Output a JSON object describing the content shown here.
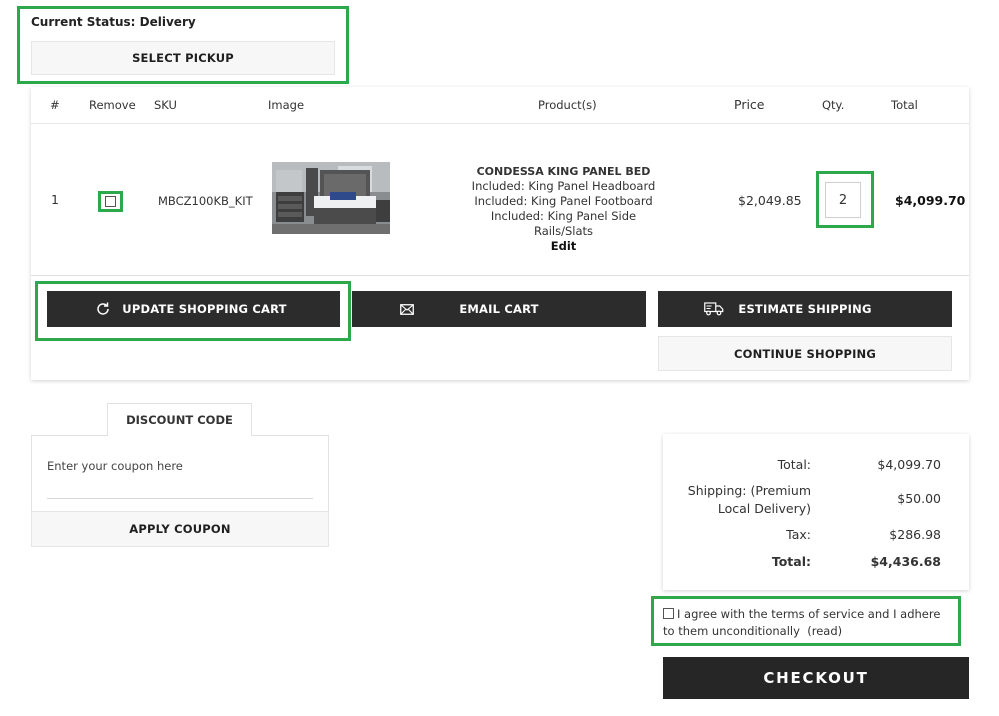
{
  "status": {
    "label": "Current Status: Delivery",
    "select_pickup": "SELECT PICKUP"
  },
  "cart": {
    "headers": {
      "num": "#",
      "remove": "Remove",
      "sku": "SKU",
      "image": "Image",
      "products": "Product(s)",
      "price": "Price",
      "qty": "Qty.",
      "total": "Total"
    },
    "items": [
      {
        "num": "1",
        "sku": "MBCZ100KB_KIT",
        "product_name": "CONDESSA KING PANEL BED",
        "included": [
          "Included: King Panel Headboard",
          "Included: King Panel Footboard",
          "Included: King Panel Side Rails/Slats"
        ],
        "edit_label": "Edit",
        "price": "$2,049.85",
        "qty": "2",
        "total": "$4,099.70"
      }
    ],
    "buttons": {
      "update": "UPDATE SHOPPING CART",
      "email": "EMAIL CART",
      "estimate": "ESTIMATE SHIPPING",
      "continue": "CONTINUE SHOPPING"
    }
  },
  "discount": {
    "tab_label": "DISCOUNT CODE",
    "placeholder": "Enter your coupon here",
    "apply_label": "APPLY COUPON"
  },
  "totals": {
    "subtotal_label": "Total:",
    "subtotal_value": "$4,099.70",
    "shipping_label": "Shipping: (Premium Local Delivery)",
    "shipping_value": "$50.00",
    "tax_label": "Tax:",
    "tax_value": "$286.98",
    "total_label": "Total:",
    "total_value": "$4,436.68"
  },
  "terms": {
    "text": "I agree with the terms of service and I adhere to them unconditionally",
    "read_link": "(read)"
  },
  "checkout_label": "CHECKOUT",
  "colors": {
    "highlight": "#2da84a",
    "dark_button": "#2c2c2c"
  }
}
